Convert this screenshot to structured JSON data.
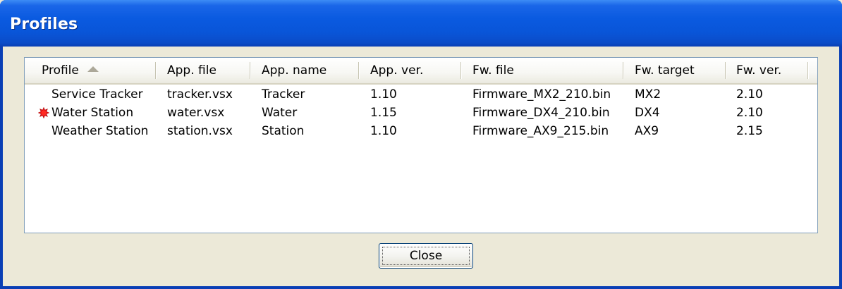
{
  "window": {
    "title": "Profiles"
  },
  "table": {
    "sorted_by": "Profile",
    "sort_direction": "ascending",
    "columns": [
      {
        "key": "profile",
        "label": "Profile"
      },
      {
        "key": "app_file",
        "label": "App. file"
      },
      {
        "key": "app_name",
        "label": "App. name"
      },
      {
        "key": "app_ver",
        "label": "App. ver."
      },
      {
        "key": "fw_file",
        "label": "Fw. file"
      },
      {
        "key": "fw_target",
        "label": "Fw. target"
      },
      {
        "key": "fw_ver",
        "label": "Fw. ver."
      }
    ],
    "rows": [
      {
        "profile": "Service Tracker",
        "app_file": "tracker.vsx",
        "app_name": "Tracker",
        "app_ver": "1.10",
        "fw_file": "Firmware_MX2_210.bin",
        "fw_target": "MX2",
        "fw_ver": "2.10",
        "icon": ""
      },
      {
        "profile": "Water Station",
        "app_file": "water.vsx",
        "app_name": "Water",
        "app_ver": "1.15",
        "fw_file": "Firmware_DX4_210.bin",
        "fw_target": "DX4",
        "fw_ver": "2.10",
        "icon": "red-star-icon"
      },
      {
        "profile": "Weather Station",
        "app_file": "station.vsx",
        "app_name": "Station",
        "app_ver": "1.10",
        "fw_file": "Firmware_AX9_215.bin",
        "fw_target": "AX9",
        "fw_ver": "2.15",
        "icon": ""
      }
    ]
  },
  "buttons": {
    "close_label": "Close"
  },
  "colors": {
    "titlebar": "#0a5ae0",
    "title_text": "#ffffff",
    "dialog_background": "#ece9d8",
    "marker": "#e8161a"
  }
}
